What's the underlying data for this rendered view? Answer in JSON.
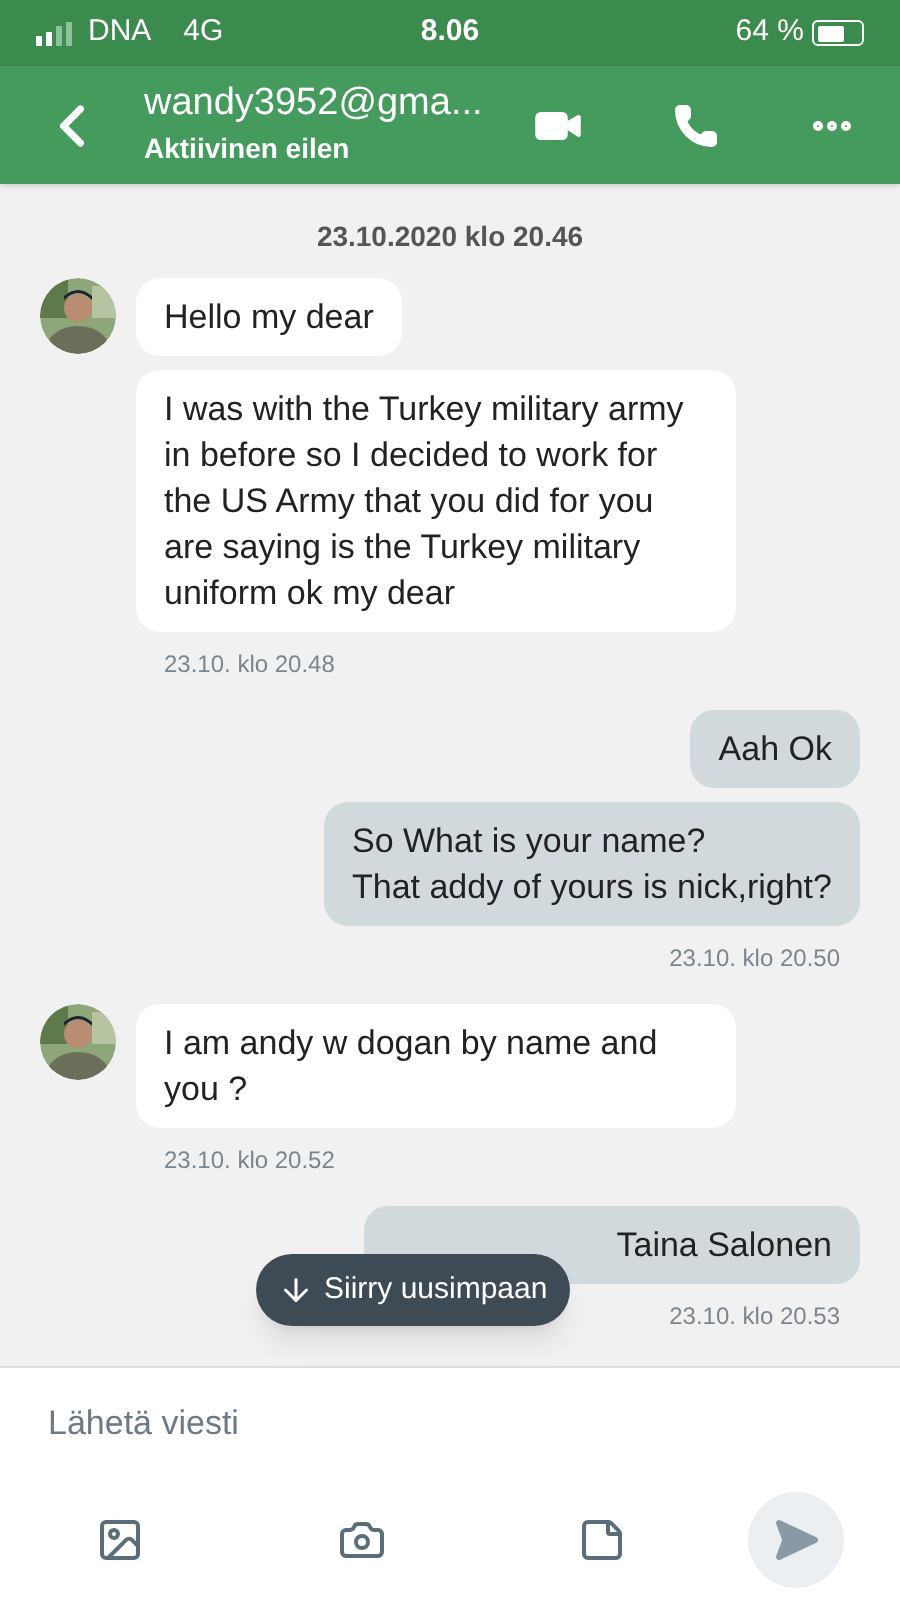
{
  "status_bar": {
    "carrier": "DNA",
    "network": "4G",
    "time": "8.06",
    "battery": "64 %"
  },
  "header": {
    "title": "wandy3952@gma...",
    "subtitle": "Aktiivinen eilen"
  },
  "messages": [
    {
      "kind": "date",
      "text": "23.10.2020 klo 20.46"
    },
    {
      "kind": "incoming",
      "avatar": true,
      "text": "Hello my dear"
    },
    {
      "kind": "incoming",
      "avatar": false,
      "text": "I was with the Turkey military army in before so I decided to work for the US Army that you did for you are saying is the Turkey military uniform ok my dear"
    },
    {
      "kind": "time-in",
      "text": "23.10. klo 20.48"
    },
    {
      "kind": "outgoing",
      "text": "Aah Ok"
    },
    {
      "kind": "outgoing",
      "text": "So What is your name?\nThat addy of yours is nick,right?"
    },
    {
      "kind": "time-out",
      "text": "23.10. klo 20.50"
    },
    {
      "kind": "incoming",
      "avatar": true,
      "text": "I am andy w dogan by name and you ?"
    },
    {
      "kind": "time-in",
      "text": "23.10. klo 20.52"
    },
    {
      "kind": "outgoing",
      "text": "Taina Salonen"
    },
    {
      "kind": "time-out",
      "text": "23.10. klo 20.53"
    }
  ],
  "jump_button": {
    "label": "Siirry uusimpaan"
  },
  "composer": {
    "placeholder": "Lähetä viesti"
  }
}
